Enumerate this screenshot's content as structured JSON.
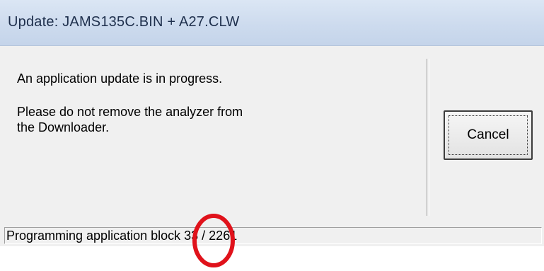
{
  "window": {
    "title": "Update: JAMS135C.BIN + A27.CLW"
  },
  "message": {
    "line1": "An application update is in progress.",
    "line2a": "Please do not remove the analyzer from",
    "line2b": "the Downloader."
  },
  "buttons": {
    "cancel": "Cancel"
  },
  "status": {
    "prefix": "Programming application block ",
    "current_block": "33",
    "separator": " / ",
    "total_blocks": "2261"
  },
  "annotation": {
    "color": "#e0121b",
    "shape": "circle-highlight"
  }
}
